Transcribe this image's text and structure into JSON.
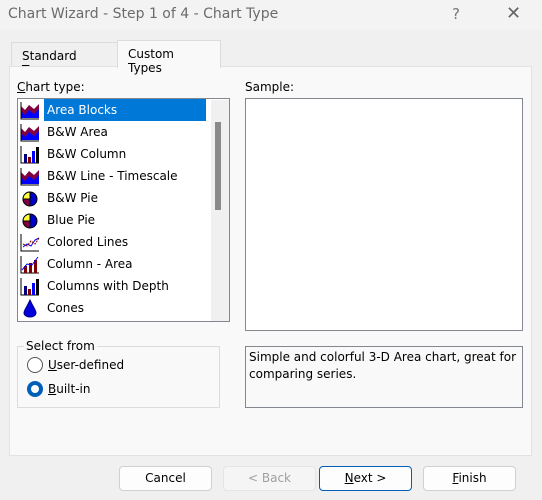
{
  "window": {
    "title": "Chart Wizard - Step 1 of 4 - Chart Type",
    "help": "?",
    "close": "✕"
  },
  "tabs": [
    {
      "label": "Standard Types",
      "active": false
    },
    {
      "label": "Custom Types",
      "active": true
    }
  ],
  "chart_type": {
    "label_u": "C",
    "label_rest": "hart type:",
    "items": [
      {
        "label": "Area Blocks",
        "icon": "area-icon",
        "selected": true
      },
      {
        "label": "B&W Area",
        "icon": "area-icon"
      },
      {
        "label": "B&W Column",
        "icon": "column-icon"
      },
      {
        "label": "B&W Line - Timescale",
        "icon": "area-icon"
      },
      {
        "label": "B&W Pie",
        "icon": "pie-icon"
      },
      {
        "label": "Blue Pie",
        "icon": "pie-icon"
      },
      {
        "label": "Colored Lines",
        "icon": "lines-icon"
      },
      {
        "label": "Column - Area",
        "icon": "column-area-icon"
      },
      {
        "label": "Columns with Depth",
        "icon": "column-icon"
      },
      {
        "label": "Cones",
        "icon": "cone-icon"
      }
    ]
  },
  "sample": {
    "label": "Sample:"
  },
  "select_from": {
    "label": "Select from",
    "options": [
      {
        "u": "U",
        "rest": "ser-defined",
        "checked": false
      },
      {
        "u": "B",
        "rest": "uilt-in",
        "checked": true
      }
    ]
  },
  "description": "Simple and colorful 3-D Area chart, great for comparing series.",
  "buttons": {
    "cancel": "Cancel",
    "back": "< Back",
    "next_u": "N",
    "next_rest": "ext >",
    "finish_u": "F",
    "finish_rest": "inish"
  },
  "colors": {
    "selection": "#0078d7",
    "radio": "#005fb8"
  }
}
